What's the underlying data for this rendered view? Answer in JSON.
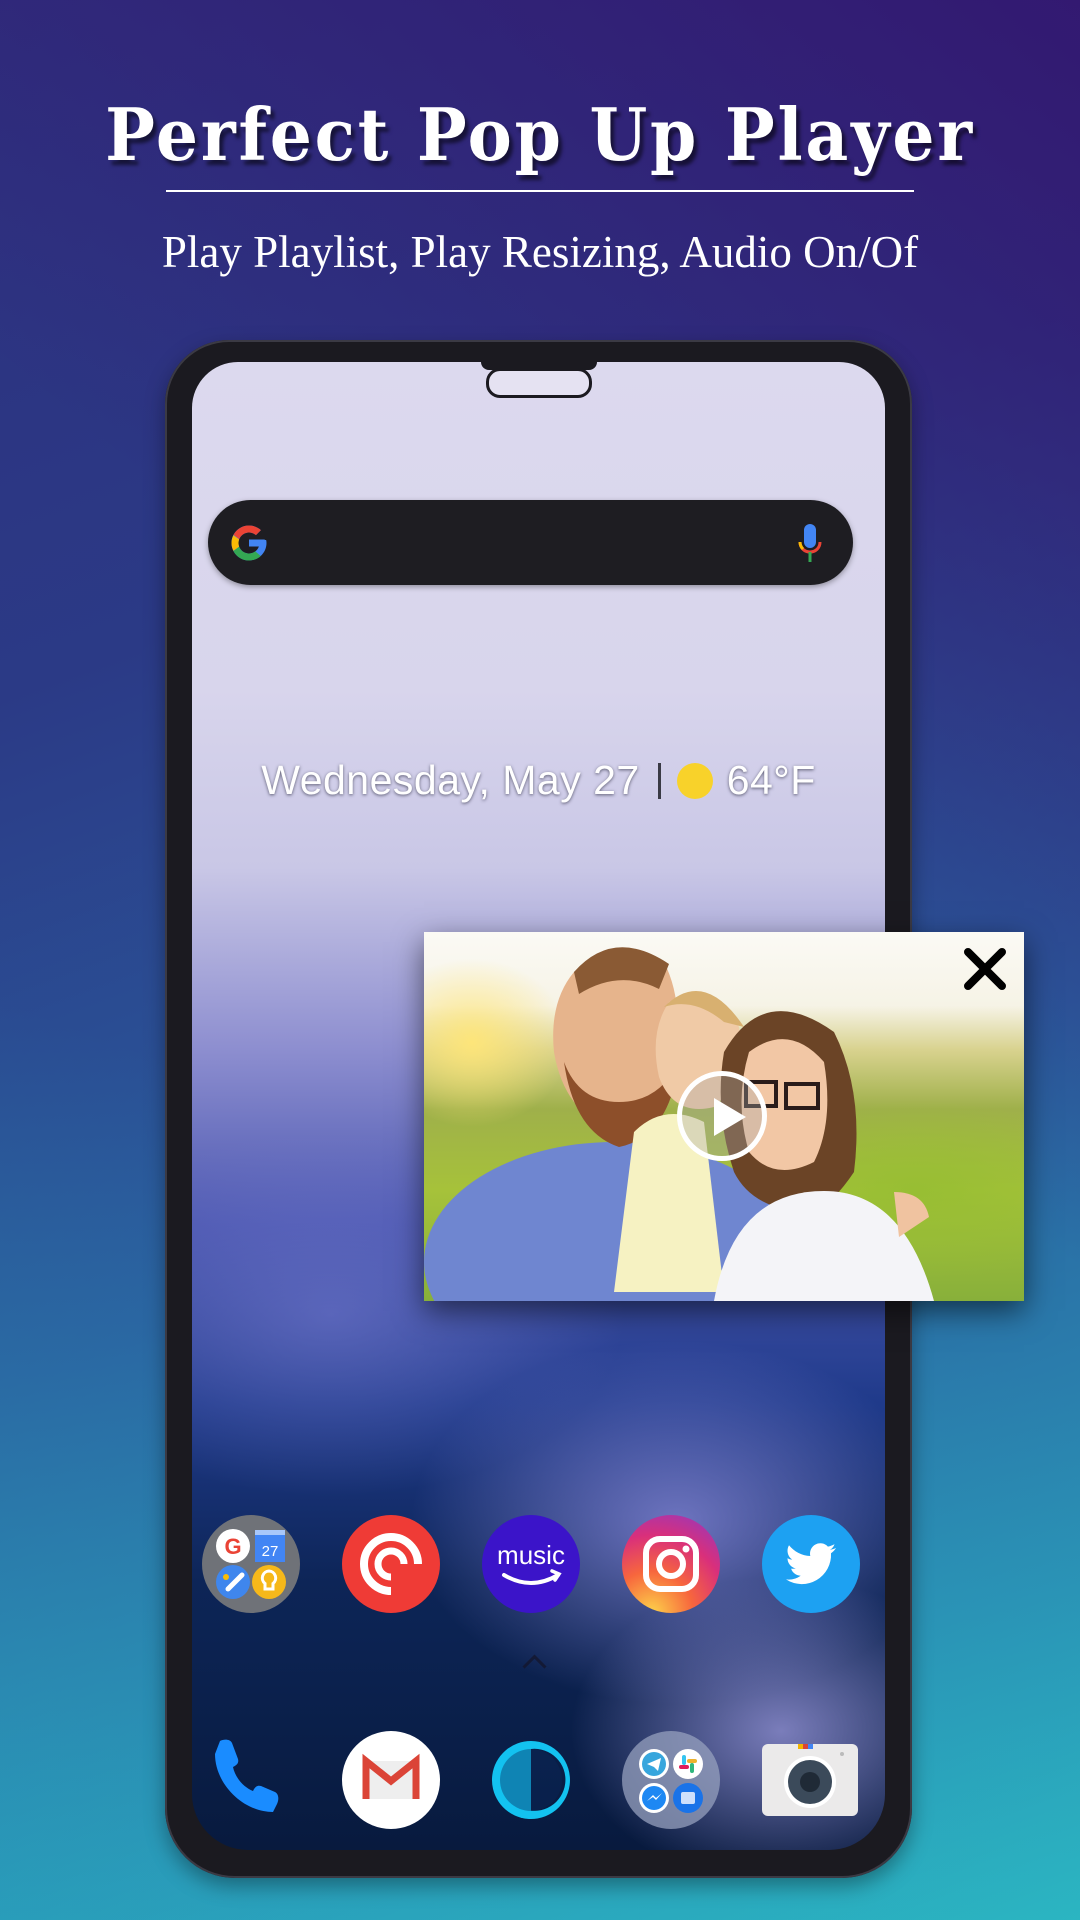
{
  "promo": {
    "title": "Perfect Pop Up Player",
    "subtitle": "Play Playlist, Play Resizing, Audio On/Of"
  },
  "home_screen": {
    "search_bar": {
      "left_icon": "google-g-icon",
      "right_icon": "microphone-icon"
    },
    "at_a_glance": {
      "date": "Wednesday, May 27",
      "weather_icon": "sun-icon",
      "temperature": "64°F"
    },
    "app_row": [
      {
        "name": "Google apps folder",
        "icon": "google-folder-icon",
        "calendar_day": "27"
      },
      {
        "name": "Pocket Casts",
        "icon": "pocket-casts-icon",
        "color": "#ef3b36"
      },
      {
        "name": "Amazon Music",
        "icon": "amazon-music-icon",
        "label": "music",
        "color": "#3b14c9"
      },
      {
        "name": "Instagram",
        "icon": "instagram-icon"
      },
      {
        "name": "Twitter",
        "icon": "twitter-icon",
        "color": "#1da1f2"
      }
    ],
    "dock": [
      {
        "name": "Phone",
        "icon": "phone-icon",
        "color": "#1a8cff"
      },
      {
        "name": "Gmail",
        "icon": "gmail-icon"
      },
      {
        "name": "Alexa",
        "icon": "alexa-icon",
        "color": "#13c2f0"
      },
      {
        "name": "Messaging folder",
        "icon": "messaging-folder-icon"
      },
      {
        "name": "Camera",
        "icon": "camera-icon"
      }
    ]
  },
  "popup_player": {
    "thumbnail": "family-photo-thumbnail",
    "close_icon": "close-icon",
    "play_icon": "play-icon"
  },
  "colors": {
    "bg_top": "#34167a",
    "bg_bottom": "#2cb3c0",
    "phone_frame": "#1b1a20"
  }
}
